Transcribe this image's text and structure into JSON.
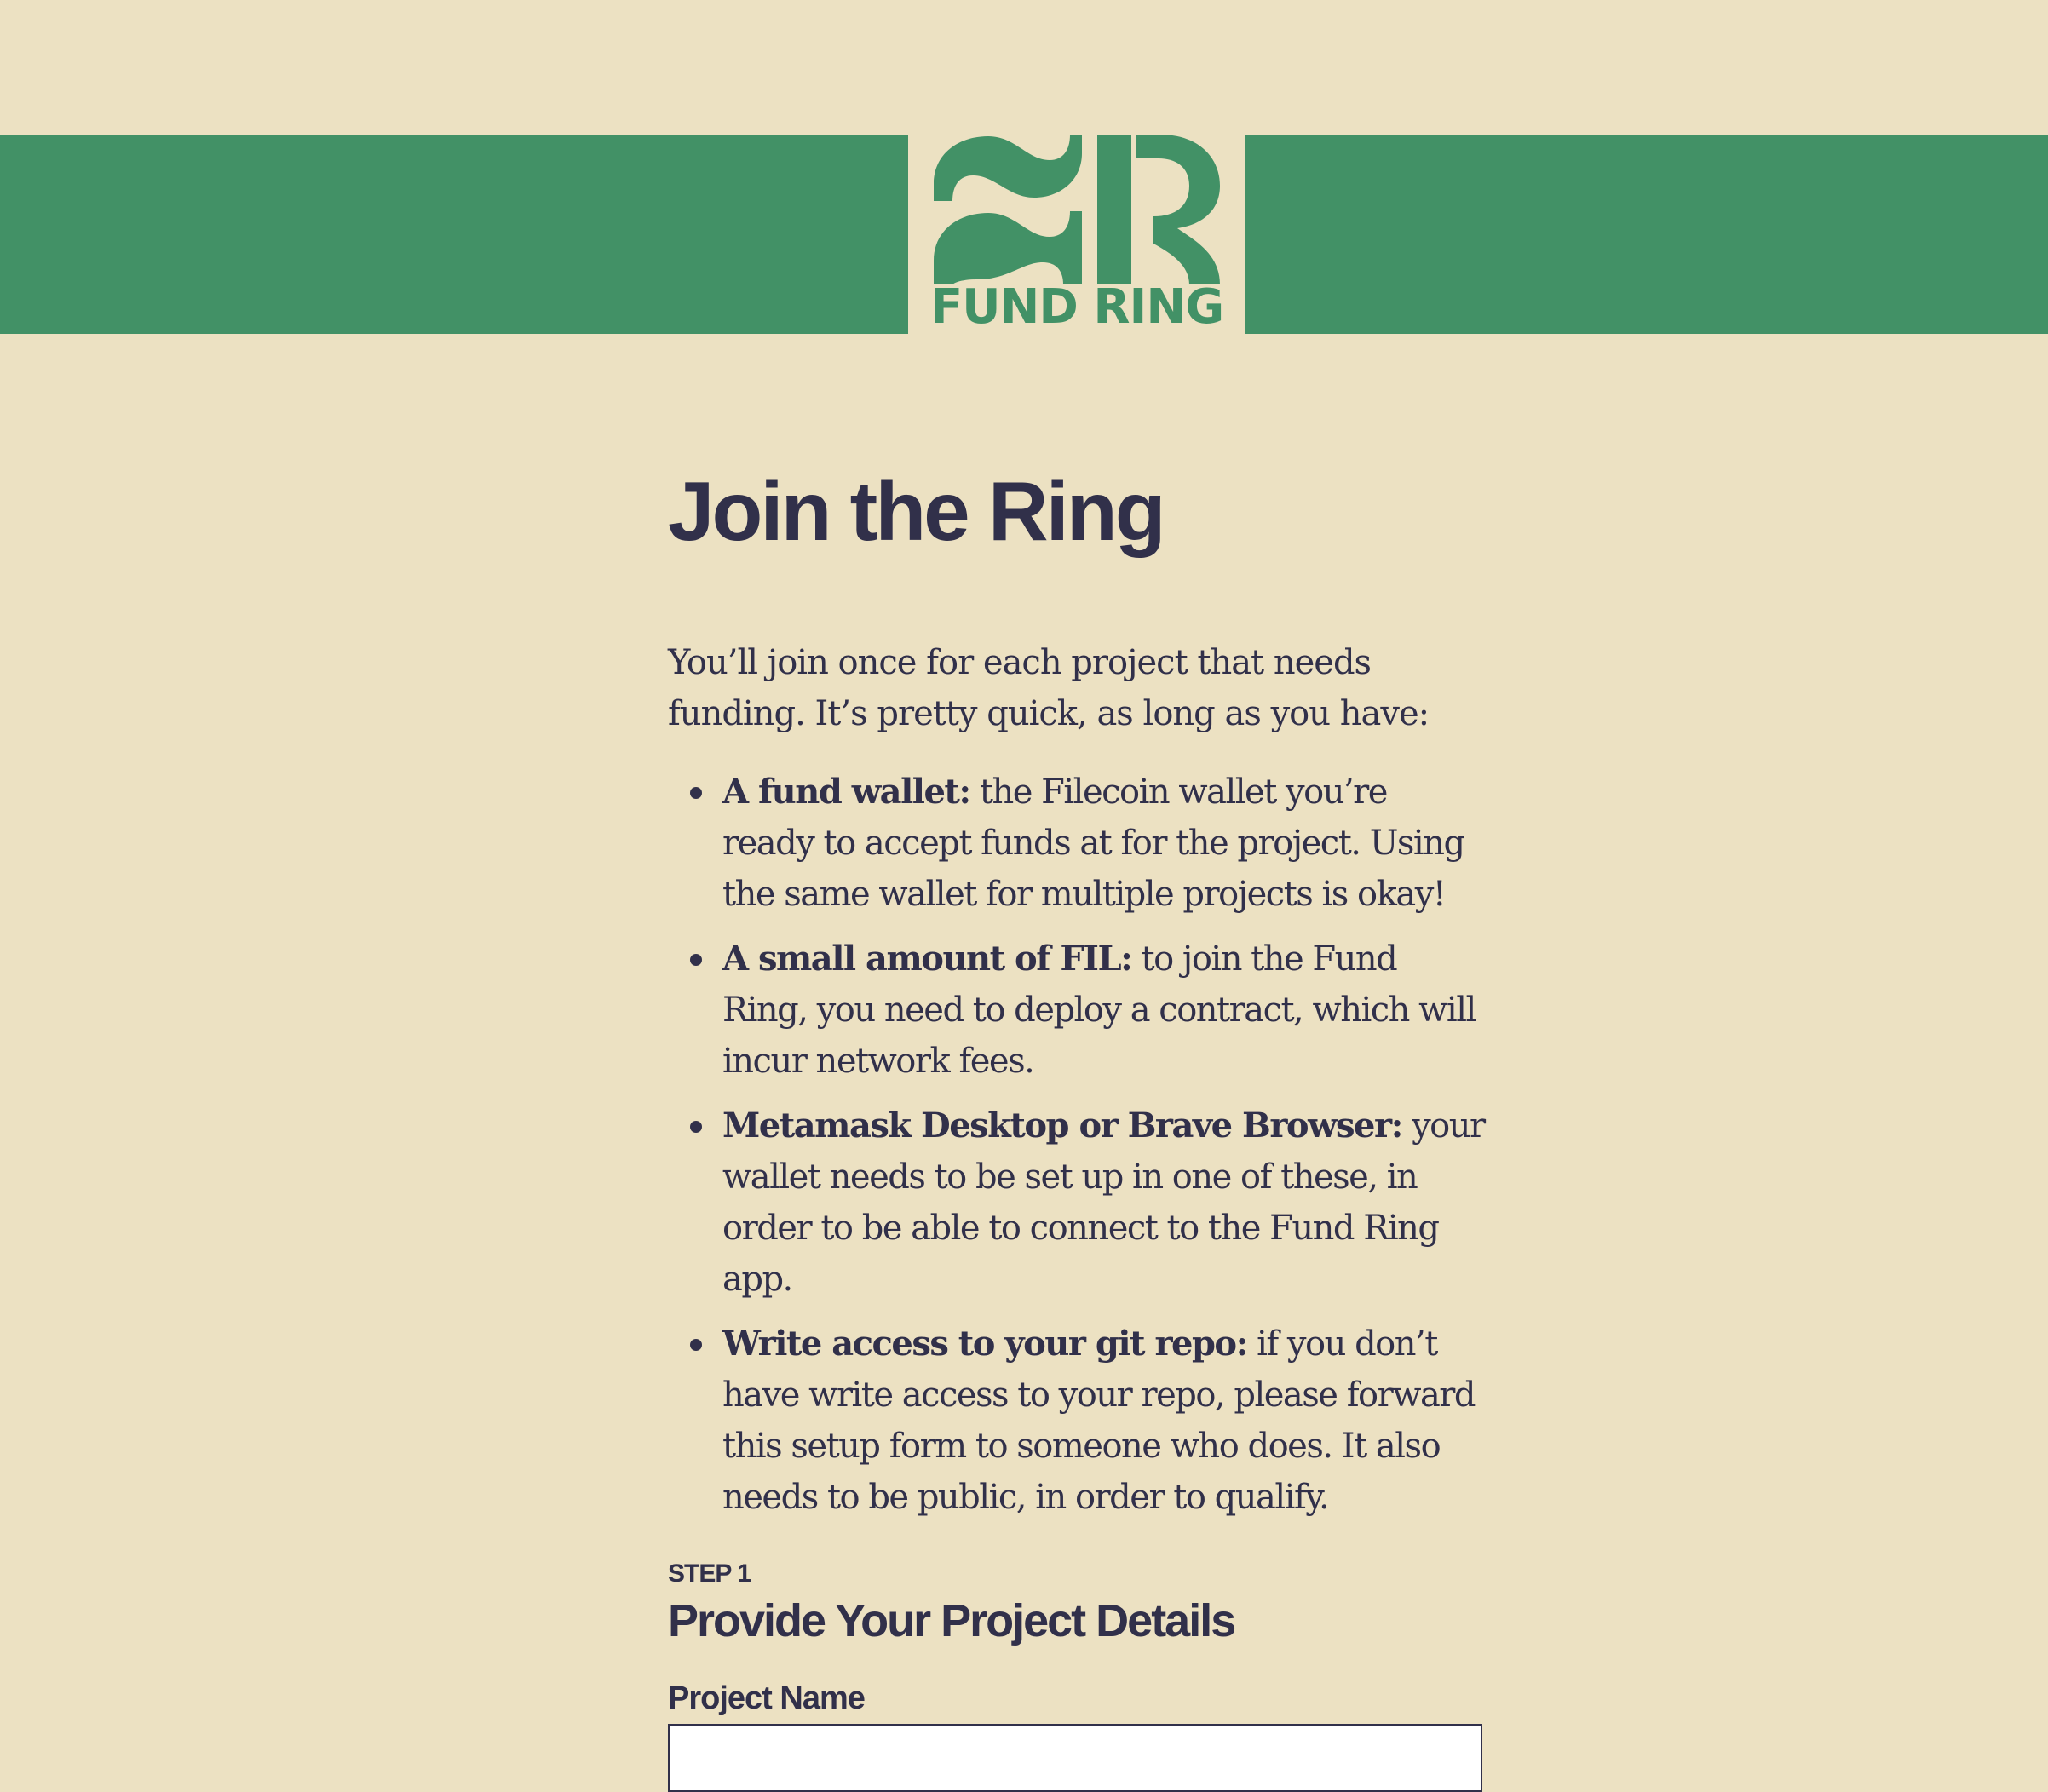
{
  "brand": {
    "name": "FUND RING",
    "logo_icon": "fund-ring-mark-icon",
    "colors": {
      "green": "#429166",
      "background": "#ece1c2",
      "text": "#31304a"
    }
  },
  "main": {
    "title": "Join the Ring",
    "intro": "You’ll join once for each project that needs funding. It’s pretty quick, as long as you have:",
    "requirements": [
      {
        "title": "A fund wallet:",
        "text": " the Filecoin wallet you’re ready to accept funds at for the project. Using the same wallet for multiple projects is okay!"
      },
      {
        "title": "A small amount of FIL:",
        "text": " to join the Fund Ring, you need to deploy a contract, which will incur network fees."
      },
      {
        "title": "Metamask Desktop or Brave Browser:",
        "text": " your wallet needs to be set up in one of these, in order to be able to connect to the Fund Ring app."
      },
      {
        "title": "Write access to your git repo:",
        "text": " if you don’t have write access to your repo, please forward this setup form to someone who does. It also needs to be public, in order to qualify."
      }
    ]
  },
  "step": {
    "label": "STEP 1",
    "title": "Provide Your Project Details",
    "field": {
      "label": "Project Name",
      "value": "",
      "placeholder": ""
    }
  }
}
